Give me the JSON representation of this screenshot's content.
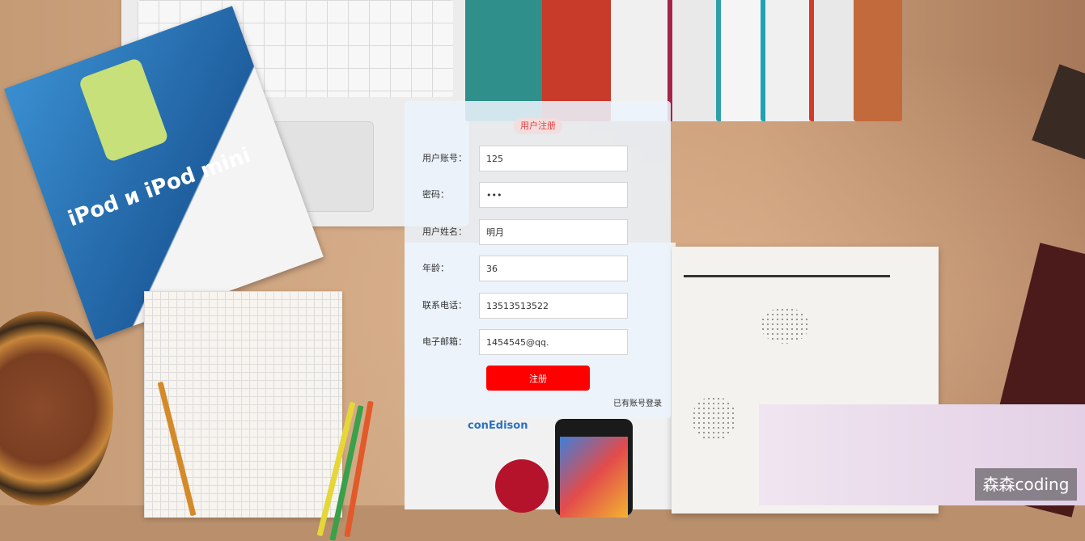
{
  "form": {
    "title": "用户注册",
    "fields": [
      {
        "label": "用户账号：",
        "value": "125",
        "type": "text"
      },
      {
        "label": "密码：",
        "value": "123",
        "type": "password"
      },
      {
        "label": "用户姓名：",
        "value": "明月",
        "type": "text"
      },
      {
        "label": "年龄：",
        "value": "36",
        "type": "text"
      },
      {
        "label": "联系电话：",
        "value": "13513513522",
        "type": "text"
      },
      {
        "label": "电子邮箱：",
        "value": "1454545@qq.",
        "type": "text"
      }
    ],
    "submit_label": "注册",
    "login_link": "已有账号登录"
  },
  "background": {
    "brochure_title": "iPod и iPod mini",
    "brand_text": "conEdison"
  },
  "watermark": "森森coding",
  "colors": {
    "accent": "#ff0000",
    "title_text": "#e04444",
    "title_bg": "#f2dede",
    "panel_bg": "#ebf2fa"
  }
}
